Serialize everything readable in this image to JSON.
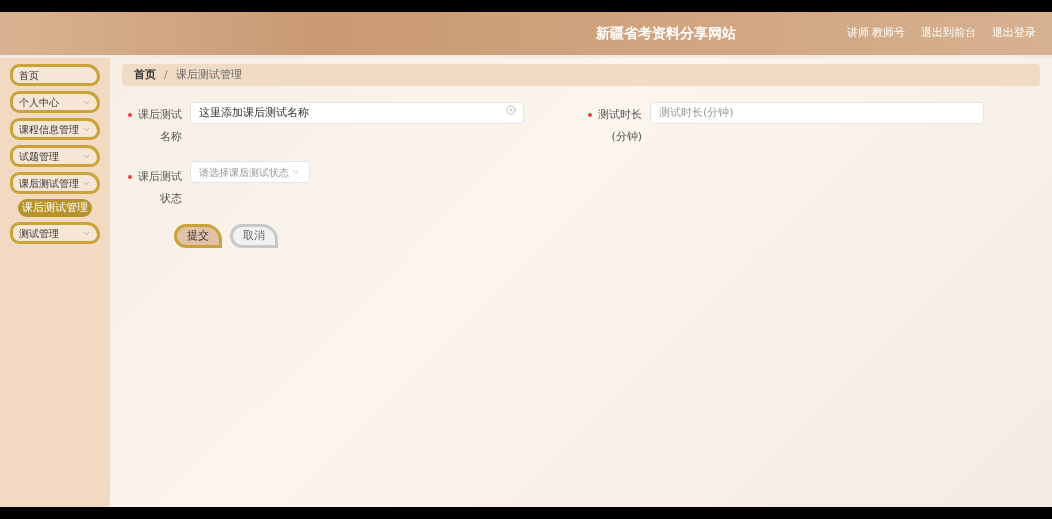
{
  "header": {
    "title": "新疆省考资料分享网站",
    "user_role": "讲师",
    "user_name": "教师号",
    "links": [
      "退出到前台",
      "退出登录"
    ]
  },
  "sidebar": {
    "items": [
      {
        "label": "首页",
        "expandable": false
      },
      {
        "label": "个人中心",
        "expandable": true
      },
      {
        "label": "课程信息管理",
        "expandable": true
      },
      {
        "label": "试题管理",
        "expandable": true
      },
      {
        "label": "课后测试管理",
        "expandable": true,
        "children": [
          {
            "label": "课后测试管理",
            "selected": true
          }
        ]
      },
      {
        "label": "测试管理",
        "expandable": true
      }
    ]
  },
  "breadcrumb": [
    "首页",
    "课后测试管理"
  ],
  "breadcrumb_separator": "/",
  "form": {
    "fields": [
      {
        "kind": "text",
        "label": "课后测试名称",
        "required": true,
        "value": "这里添加课后测试名称"
      },
      {
        "kind": "text",
        "label": "测试时长(分钟)",
        "required": true,
        "placeholder": "测试时长(分钟)"
      },
      {
        "kind": "select",
        "label": "课后测试状态",
        "required": true,
        "placeholder": "请选择课后测试状态"
      }
    ],
    "buttons": [
      {
        "label": "提交",
        "kind": "primary"
      },
      {
        "label": "取消",
        "kind": "secondary"
      }
    ]
  }
}
